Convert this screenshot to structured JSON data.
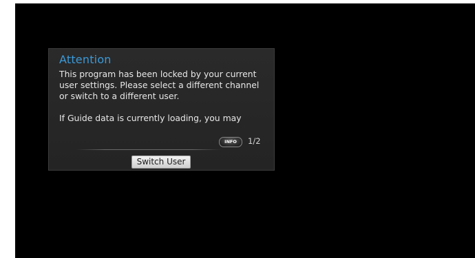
{
  "dialog": {
    "title": "Attention",
    "message_lines": [
      "This program has been locked by your current",
      "user settings. Please select a different channel",
      "or switch to a different user."
    ],
    "message_more": "If Guide data is currently loading, you may",
    "info_button_label": "INFO",
    "page_indicator": "1/2",
    "switch_user_label": "Switch User"
  },
  "colors": {
    "background": "#000000",
    "dialog_bg": "#262626",
    "title": "#3b9ad9",
    "text": "#e8e8e8"
  }
}
